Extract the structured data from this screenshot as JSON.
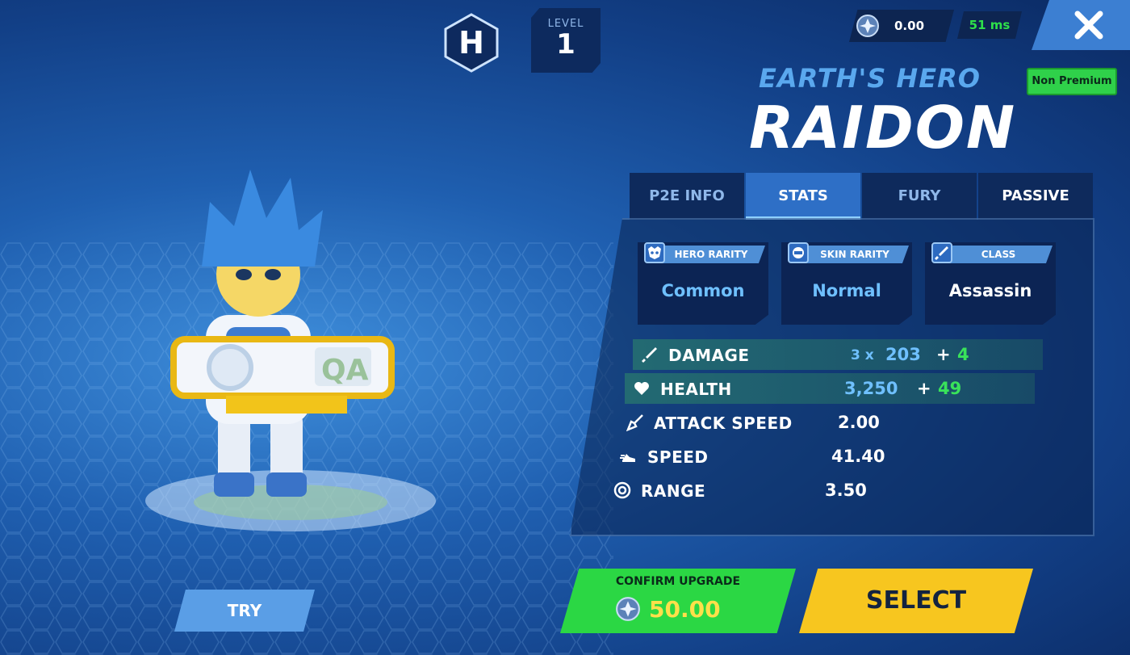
{
  "rank": {
    "letter": "H"
  },
  "level": {
    "label": "LEVEL",
    "value": "1"
  },
  "currency": {
    "value": "0.00",
    "icon": "gem-coin-icon"
  },
  "ping": {
    "value": "51 ms",
    "color": "#2ee04a"
  },
  "premium_badge": "Non Premium",
  "hero": {
    "subtitle": "EARTH'S HERO",
    "name": "RAIDON"
  },
  "tabs": [
    {
      "label": "P2E INFO",
      "active": false
    },
    {
      "label": "STATS",
      "active": true
    },
    {
      "label": "FURY",
      "active": false
    },
    {
      "label": "PASSIVE",
      "active": false
    }
  ],
  "rarity": [
    {
      "heading": "HERO RARITY",
      "value": "Common",
      "icon": "hero-mask-icon"
    },
    {
      "heading": "SKIN RARITY",
      "value": "Normal",
      "icon": "skin-helmet-icon"
    },
    {
      "heading": "CLASS",
      "value": "Assassin",
      "icon": "sword-icon"
    }
  ],
  "stats": {
    "damage": {
      "label": "DAMAGE",
      "prefix": "3 x",
      "base": "203",
      "plus": "+",
      "bonus": "4"
    },
    "health": {
      "label": "HEALTH",
      "base": "3,250",
      "plus": "+",
      "bonus": "49"
    },
    "attack_speed": {
      "label": "ATTACK SPEED",
      "value": "2.00"
    },
    "speed": {
      "label": "SPEED",
      "value": "41.40"
    },
    "range": {
      "label": "RANGE",
      "value": "3.50"
    }
  },
  "buttons": {
    "confirm_label": "CONFIRM UPGRADE",
    "confirm_cost": "50.00",
    "select": "SELECT",
    "try": "TRY"
  },
  "colors": {
    "accent_blue": "#2e6fc6",
    "green": "#2bd744",
    "yellow": "#f7c61f",
    "bonus_green": "#39e35a"
  }
}
